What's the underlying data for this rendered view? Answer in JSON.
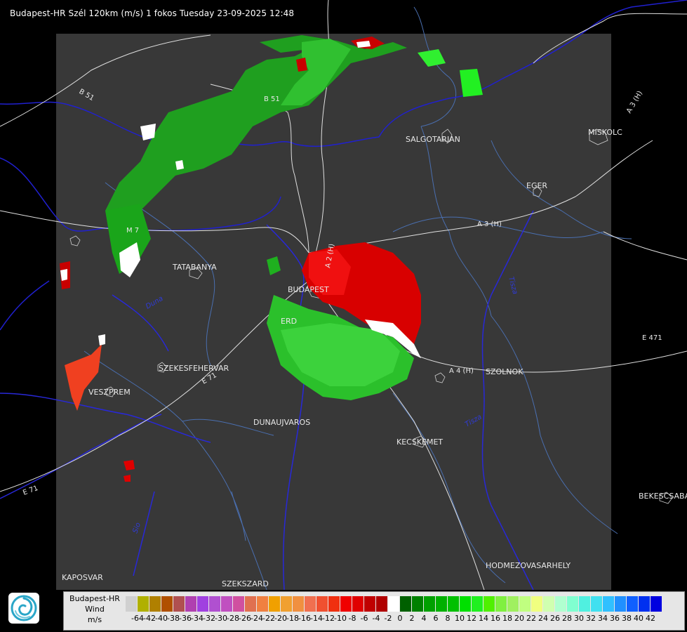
{
  "title": "Budapest-HR Szél 120km (m/s) 1 fokos Tuesday 23-09-2025 12:48",
  "logo_icon": "omsz-swirl-logo-icon",
  "cities": [
    {
      "name": "SALGOTARJAN"
    },
    {
      "name": "MISKOLC"
    },
    {
      "name": "EGER"
    },
    {
      "name": "TATABANYA"
    },
    {
      "name": "BUDAPEST"
    },
    {
      "name": "ERD"
    },
    {
      "name": "SZEKESFEHERVAR"
    },
    {
      "name": "VESZPREM"
    },
    {
      "name": "DUNAUJVAROS"
    },
    {
      "name": "KECSKEMET"
    },
    {
      "name": "SZOLNOK"
    },
    {
      "name": "BEKESCSABA"
    },
    {
      "name": "HODMEZOVASARHELY"
    },
    {
      "name": "KAPOSVAR"
    },
    {
      "name": "SZEKSZARD"
    }
  ],
  "road_labels": [
    "B 51",
    "B 51",
    "A 3 (H)",
    "A 3 (H)",
    "A 2 (H)",
    "A 4 (H)",
    "E 71",
    "E 71",
    "E 471",
    "M 7"
  ],
  "river_labels": [
    "Tisza",
    "Tisza",
    "Duna",
    "Sio"
  ],
  "legend": {
    "line1": "Budapest-HR",
    "line2": "Wind",
    "line3": "m/s",
    "swatch_colors": [
      "#d0d0d0",
      "#b0b000",
      "#b08000",
      "#b05000",
      "#b05050",
      "#b040b0",
      "#a040e0",
      "#b050d0",
      "#c050c0",
      "#d050a0",
      "#e07050",
      "#f08040",
      "#f0a000",
      "#f0a030",
      "#f09040",
      "#f07050",
      "#f05030",
      "#f03010",
      "#f00000",
      "#e00000",
      "#c00000",
      "#b00000",
      "#ffffff",
      "#006000",
      "#008000",
      "#00a000",
      "#00b000",
      "#00c000",
      "#00e000",
      "#20f020",
      "#50f000",
      "#80f040",
      "#a0f060",
      "#c0ff80",
      "#f0ff80",
      "#d0ffb0",
      "#b0ffd0",
      "#80ffd0",
      "#50f0e0",
      "#40e0f0",
      "#30c0ff",
      "#2090ff",
      "#1060ff",
      "#0030f0",
      "#0000e0"
    ],
    "ticks": [
      "-64",
      "-42",
      "-40",
      "-38",
      "-36",
      "-34",
      "-32",
      "-30",
      "-28",
      "-26",
      "-24",
      "-22",
      "-20",
      "-18",
      "-16",
      "-14",
      "-12",
      "-10",
      "-8",
      "-6",
      "-4",
      "-2",
      "0",
      "2",
      "4",
      "6",
      "8",
      "10",
      "12",
      "14",
      "16",
      "18",
      "20",
      "22",
      "24",
      "26",
      "28",
      "30",
      "32",
      "34",
      "36",
      "38",
      "40",
      "42"
    ]
  }
}
